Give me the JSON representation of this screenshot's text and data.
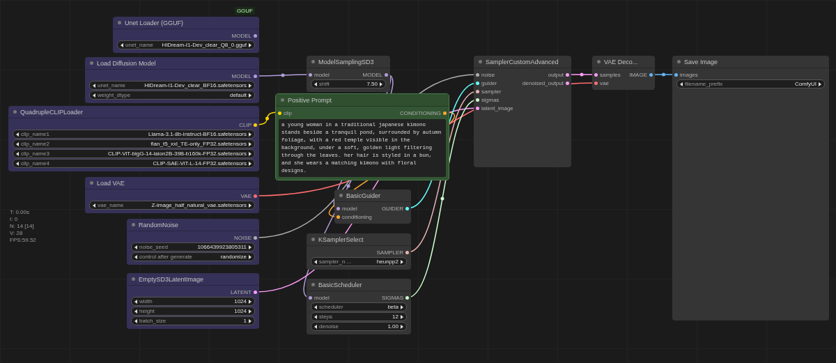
{
  "stats": [
    "T: 0.00s",
    "I: 0",
    "N: 14 [14]",
    "V: 28",
    "FPS:59.52"
  ],
  "nodes": [
    {
      "title": "Unet Loader (GGUF)",
      "kind": "loader",
      "badge": "GGUF",
      "outputs": [
        {
          "label": "MODEL",
          "color": "#b39ddb"
        }
      ],
      "widgets": [
        {
          "name": "unet_name",
          "value": "HiDream-I1-Dev_clear_Q8_0.gguf"
        }
      ]
    },
    {
      "title": "Load Diffusion Model",
      "kind": "loader",
      "outputs": [
        {
          "label": "MODEL",
          "color": "#b39ddb"
        }
      ],
      "widgets": [
        {
          "name": "unet_name",
          "value": "HiDream-I1-Dev_clear_BF16.safetensors"
        },
        {
          "name": "weight_dtype",
          "value": "default"
        }
      ]
    },
    {
      "title": "QuadrupleCLIPLoader",
      "kind": "loader",
      "outputs": [
        {
          "label": "CLIP",
          "color": "#ffd500"
        }
      ],
      "widgets": [
        {
          "name": "clip_name1",
          "value": "Llama-3.1-8b-instruct-BF16.safetensors"
        },
        {
          "name": "clip_name2",
          "value": "flan_t5_xxl_TE-only_FP32.safetensors"
        },
        {
          "name": "clip_name3",
          "value": "CLIP-ViT-bigG-14-laion2B-39B-b160k-FP32.safetensors"
        },
        {
          "name": "clip_name4",
          "value": "CLIP-SAE-ViT-L-14-FP32.safetensors"
        }
      ]
    },
    {
      "title": "Load VAE",
      "kind": "loader",
      "outputs": [
        {
          "label": "VAE",
          "color": "#ff6e6e"
        }
      ],
      "widgets": [
        {
          "name": "vae_name",
          "value": "Z-image_half_natural_vae.safetensors"
        }
      ]
    },
    {
      "title": "RandomNoise",
      "kind": "loader",
      "outputs": [
        {
          "label": "NOISE",
          "color": "#b0b0b0"
        }
      ],
      "widgets": [
        {
          "name": "noise_seed",
          "value": "1066439923805311"
        },
        {
          "name": "control after generate",
          "value": "randomize"
        }
      ]
    },
    {
      "title": "EmptySD3LatentImage",
      "kind": "loader",
      "outputs": [
        {
          "label": "LATENT",
          "color": "#ff9cf9"
        }
      ],
      "widgets": [
        {
          "name": "width",
          "value": "1024"
        },
        {
          "name": "height",
          "value": "1024"
        },
        {
          "name": "batch_size",
          "value": "1"
        }
      ]
    },
    {
      "title": "ModelSamplingSD3",
      "kind": "default",
      "inputs": [
        {
          "label": "model",
          "color": "#b39ddb"
        }
      ],
      "outputs": [
        {
          "label": "MODEL",
          "color": "#b39ddb"
        }
      ],
      "widgets": [
        {
          "name": "shift",
          "value": "7.50"
        }
      ]
    },
    {
      "title": "Positive Prompt",
      "kind": "prompt",
      "inputs": [
        {
          "label": "clip",
          "color": "#ffd500"
        }
      ],
      "outputs": [
        {
          "label": "CONDITIONING",
          "color": "#ffa931"
        }
      ],
      "text": "a young woman in a traditional japanese kimono stands beside a tranquil pond, surrounded by autumn foliage, with a red temple visible in the background, under a soft, golden light filtering through the leaves. her hair is styled in a bun, and she wears a matching kimono with floral designs."
    },
    {
      "title": "BasicGuider",
      "kind": "default",
      "inputs": [
        {
          "label": "model",
          "color": "#b39ddb"
        },
        {
          "label": "conditioning",
          "color": "#ffa931"
        }
      ],
      "outputs": [
        {
          "label": "GUIDER",
          "color": "#66ffff"
        }
      ]
    },
    {
      "title": "KSamplerSelect",
      "kind": "default",
      "outputs": [
        {
          "label": "SAMPLER",
          "color": "#ecb4b4"
        }
      ],
      "widgets": [
        {
          "name": "sampler_n ...",
          "value": "heunpp2"
        }
      ]
    },
    {
      "title": "BasicScheduler",
      "kind": "default",
      "inputs": [
        {
          "label": "model",
          "color": "#b39ddb"
        }
      ],
      "outputs": [
        {
          "label": "SIGMAS",
          "color": "#cdffcd"
        }
      ],
      "widgets": [
        {
          "name": "scheduler",
          "value": "beta"
        },
        {
          "name": "steps",
          "value": "12"
        },
        {
          "name": "denoise",
          "value": "1.00"
        }
      ]
    },
    {
      "title": "SamplerCustomAdvanced",
      "kind": "default",
      "inputs": [
        {
          "label": "noise",
          "color": "#b0b0b0"
        },
        {
          "label": "guider",
          "color": "#66ffff"
        },
        {
          "label": "sampler",
          "color": "#ecb4b4"
        },
        {
          "label": "sigmas",
          "color": "#cdffcd"
        },
        {
          "label": "latent_image",
          "color": "#ff9cf9"
        }
      ],
      "outputs": [
        {
          "label": "output",
          "color": "#ff9cf9"
        },
        {
          "label": "denoised_output",
          "color": "#ff9cf9"
        }
      ]
    },
    {
      "title": "VAE Deco...",
      "kind": "default",
      "inputs": [
        {
          "label": "samples",
          "color": "#ff9cf9"
        },
        {
          "label": "vae",
          "color": "#ff6e6e"
        }
      ],
      "outputs": [
        {
          "label": "IMAGE",
          "color": "#64b5f6"
        }
      ]
    },
    {
      "title": "Save Image",
      "kind": "default",
      "inputs": [
        {
          "label": "images",
          "color": "#64b5f6"
        }
      ],
      "widgets": [
        {
          "name": "filename_prefix",
          "value": "ComfyUI"
        }
      ]
    }
  ]
}
